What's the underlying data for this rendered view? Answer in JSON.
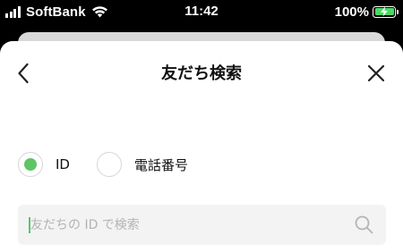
{
  "status_bar": {
    "carrier": "SoftBank",
    "time": "11:42",
    "battery_percent": "100%"
  },
  "nav": {
    "title": "友だち検索",
    "back_icon": "chevron-left-icon",
    "close_icon": "close-icon"
  },
  "search_type": {
    "options": [
      {
        "label": "ID",
        "selected": true
      },
      {
        "label": "電話番号",
        "selected": false
      }
    ]
  },
  "search": {
    "placeholder": "友だちの ID で検索",
    "value": "",
    "icon": "search-icon"
  },
  "colors": {
    "accent": "#5ec466",
    "battery": "#4cd964"
  }
}
